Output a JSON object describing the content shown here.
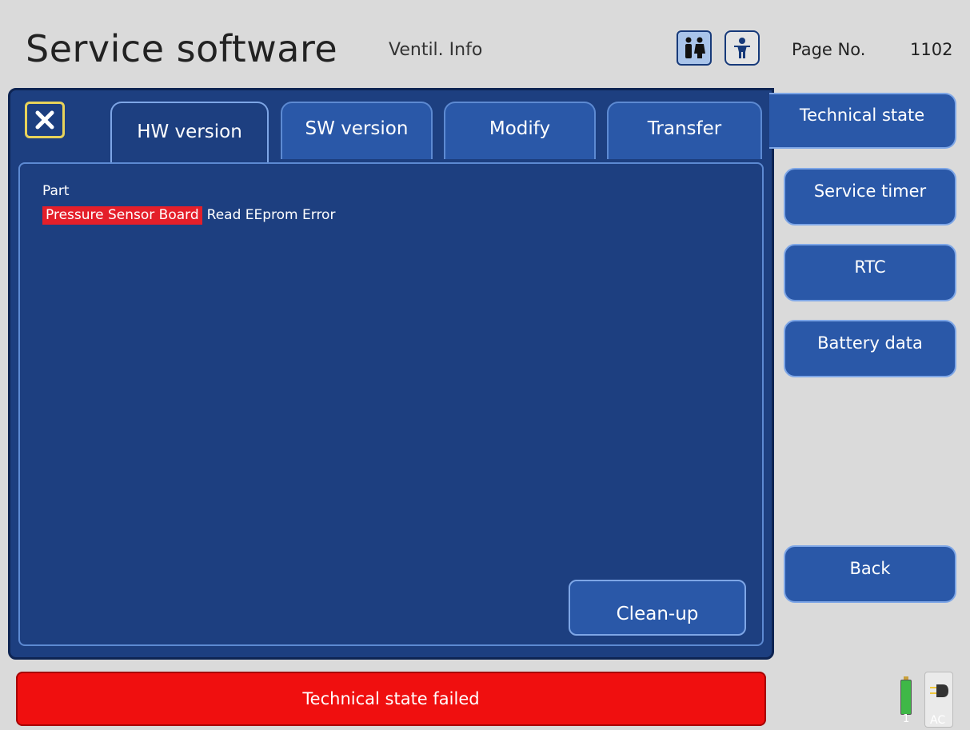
{
  "header": {
    "app_title": "Service software",
    "screen_name": "Ventil. Info",
    "page_label": "Page No.",
    "page_number": "1102",
    "patient_modes": [
      "adult-icon",
      "child-icon"
    ]
  },
  "tabs": [
    {
      "label": "HW version",
      "active": true
    },
    {
      "label": "SW version",
      "active": false
    },
    {
      "label": "Modify",
      "active": false
    },
    {
      "label": "Transfer",
      "active": false
    }
  ],
  "content": {
    "column_header": "Part",
    "rows": [
      {
        "part": "Pressure Sensor Board",
        "status": "Read EEprom Error"
      }
    ],
    "cleanup_label": "Clean-up"
  },
  "sidebar": {
    "technical_state": "Technical state",
    "service_timer": "Service timer",
    "rtc": "RTC",
    "battery_data": "Battery data",
    "back": "Back"
  },
  "status": {
    "message": "Technical state failed",
    "battery_number": "1",
    "power_source": "AC"
  },
  "colors": {
    "panel": "#1d3f80",
    "button": "#2a58a8",
    "error": "#f00f0f",
    "highlight": "#e41f2a"
  }
}
